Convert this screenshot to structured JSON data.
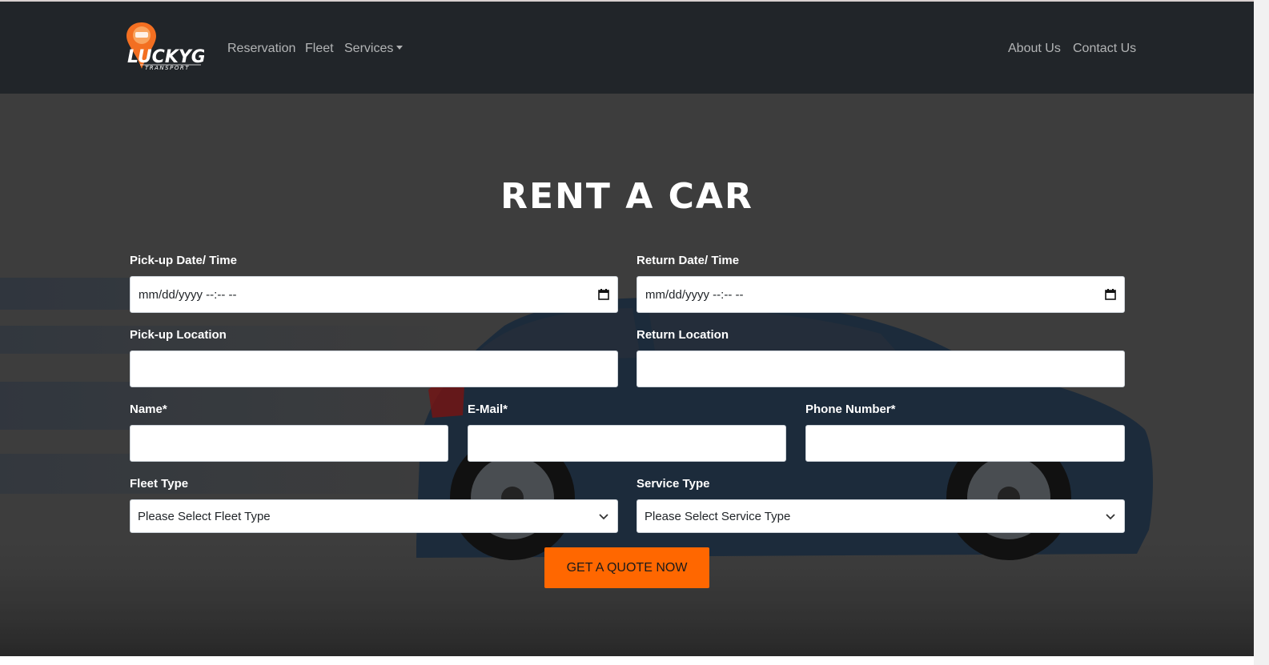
{
  "brand": {
    "logo_text": "LUCKYG",
    "logo_subtext": "TRANSPORT"
  },
  "nav": {
    "reservation": "Reservation",
    "fleet": "Fleet",
    "services": "Services",
    "about": "About Us",
    "contact": "Contact Us"
  },
  "hero": {
    "title": "RENT A CAR"
  },
  "form": {
    "pickup_datetime": {
      "label": "Pick-up Date/ Time",
      "value": "mm/dd/yyyy --:-- --"
    },
    "return_datetime": {
      "label": "Return Date/ Time",
      "value": "mm/dd/yyyy --:-- --"
    },
    "pickup_location": {
      "label": "Pick-up Location",
      "value": ""
    },
    "return_location": {
      "label": "Return Location",
      "value": ""
    },
    "name": {
      "label": "Name*",
      "value": ""
    },
    "email": {
      "label": "E-Mail*",
      "value": ""
    },
    "phone": {
      "label": "Phone Number*",
      "value": ""
    },
    "fleet_type": {
      "label": "Fleet Type",
      "selected": "Please Select Fleet Type"
    },
    "service_type": {
      "label": "Service Type",
      "selected": "Please Select Service Type"
    },
    "submit_label": "GET A QUOTE NOW"
  },
  "colors": {
    "navbar_bg": "#212529",
    "hero_overlay": "#4b4b4b",
    "accent": "#ff6700",
    "car_blue": "#1c3148"
  },
  "icons": [
    "logo-pin-icon",
    "calendar-icon",
    "chevron-down-icon",
    "caret-down-icon"
  ]
}
